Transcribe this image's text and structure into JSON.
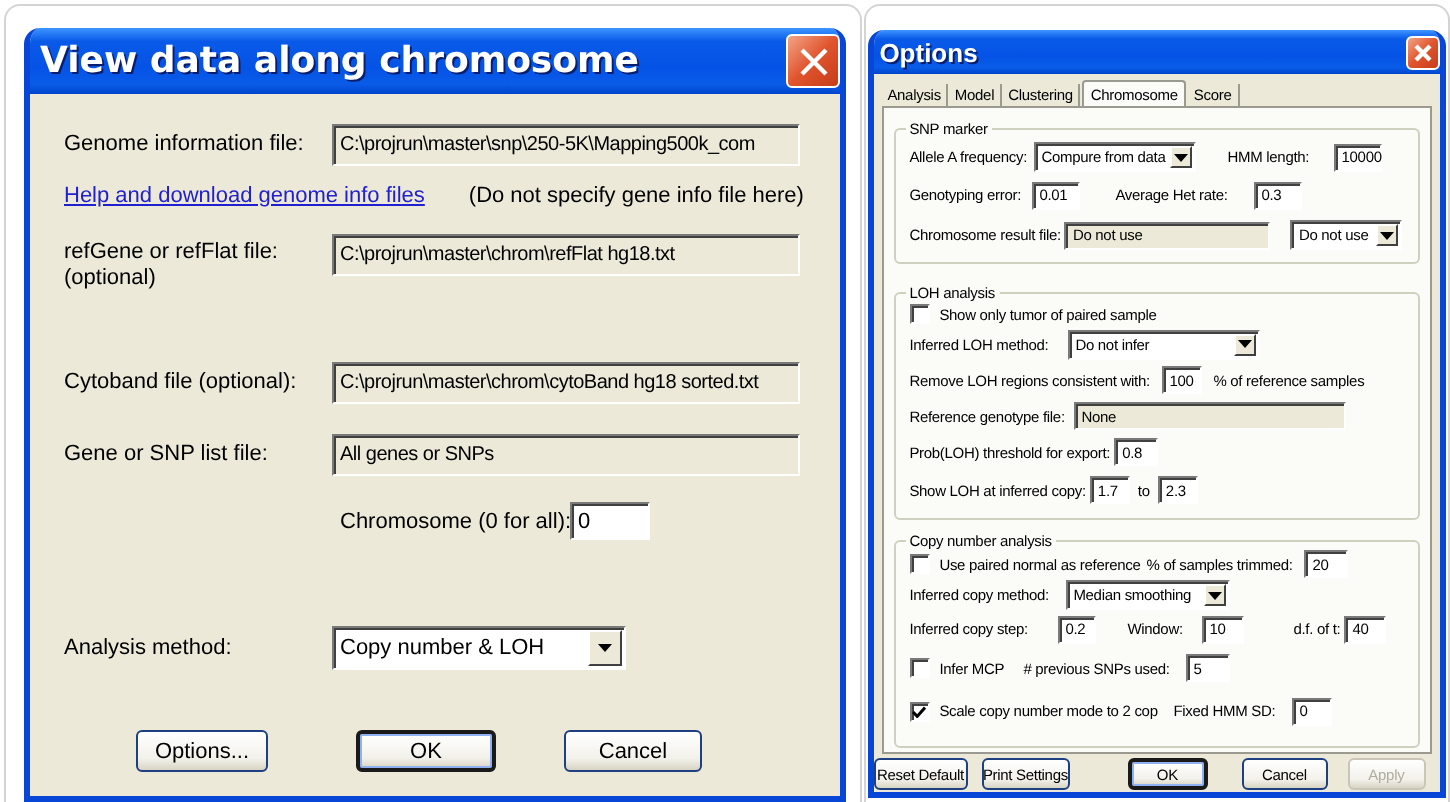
{
  "view_dialog": {
    "title": "View data along chromosome",
    "rows": [
      {
        "kind": "file",
        "label": "Genome information file:",
        "value": "C:\\projrun\\master\\snp\\250-5K\\Mapping500k_com"
      },
      {
        "kind": "link",
        "link": "Help and download genome info files",
        "note": "(Do not specify gene info file here)"
      },
      {
        "kind": "file",
        "label": "refGene or refFlat file:\n(optional)",
        "value": "C:\\projrun\\master\\chrom\\refFlat hg18.txt"
      },
      {
        "kind": "file",
        "label": "Cytoband file (optional):",
        "value": "C:\\projrun\\master\\chrom\\cytoBand hg18 sorted.txt"
      },
      {
        "kind": "file",
        "label": "Gene or SNP list file:",
        "value": "All genes or SNPs"
      },
      {
        "kind": "number",
        "label": "Chromosome (0 for all):",
        "value": "0"
      },
      {
        "kind": "select",
        "label": "Analysis method:",
        "value": "Copy number & LOH"
      }
    ],
    "buttons": [
      {
        "label": "Options...",
        "default": false
      },
      {
        "label": "OK",
        "default": true
      },
      {
        "label": "Cancel",
        "default": false
      }
    ]
  },
  "options": {
    "title": "Options",
    "tabs": [
      {
        "label": "Analysis",
        "selected": false
      },
      {
        "label": "Model",
        "selected": false
      },
      {
        "label": "Clustering",
        "selected": false
      },
      {
        "label": "Chromosome",
        "selected": true
      },
      {
        "label": "Score",
        "selected": false
      }
    ],
    "groups": [
      {
        "title": "SNP marker",
        "rows": [
          {
            "items": [
              {
                "kind": "label",
                "text": "Allele A frequency:"
              },
              {
                "kind": "select",
                "value": "Compure from data"
              },
              {
                "kind": "label",
                "text": "HMM length:"
              },
              {
                "kind": "field",
                "value": "10000"
              }
            ]
          },
          {
            "items": [
              {
                "kind": "label",
                "text": "Genotyping error:"
              },
              {
                "kind": "field",
                "value": "0.01"
              },
              {
                "kind": "label",
                "text": "Average Het rate:"
              },
              {
                "kind": "field",
                "value": "0.3"
              }
            ]
          },
          {
            "items": [
              {
                "kind": "label",
                "text": "Chromosome result file:"
              },
              {
                "kind": "readonly",
                "value": "Do not use"
              },
              {
                "kind": "select",
                "value": "Do not use"
              }
            ]
          }
        ]
      },
      {
        "title": "LOH analysis",
        "rows": [
          {
            "items": [
              {
                "kind": "checkbox",
                "label": "Show only tumor of paired sample",
                "checked": false
              }
            ]
          },
          {
            "items": [
              {
                "kind": "label",
                "text": "Inferred LOH method:"
              },
              {
                "kind": "select",
                "value": "Do not infer"
              }
            ]
          },
          {
            "items": [
              {
                "kind": "label",
                "text": "Remove LOH regions consistent with:"
              },
              {
                "kind": "field",
                "value": "100"
              },
              {
                "kind": "label",
                "text": "% of reference samples"
              }
            ]
          },
          {
            "items": [
              {
                "kind": "label",
                "text": "Reference genotype file:"
              },
              {
                "kind": "readonly",
                "value": "None"
              }
            ]
          },
          {
            "items": [
              {
                "kind": "label",
                "text": "Prob(LOH) threshold for export:"
              },
              {
                "kind": "field",
                "value": "0.8"
              }
            ]
          },
          {
            "items": [
              {
                "kind": "label",
                "text": "Show LOH at inferred copy:"
              },
              {
                "kind": "field",
                "value": "1.7"
              },
              {
                "kind": "label",
                "text": "to"
              },
              {
                "kind": "field",
                "value": "2.3"
              }
            ]
          }
        ]
      },
      {
        "title": "Copy number analysis",
        "rows": [
          {
            "items": [
              {
                "kind": "checkbox",
                "label": "Use paired normal as reference",
                "checked": false
              },
              {
                "kind": "label",
                "text": "% of samples trimmed:"
              },
              {
                "kind": "field",
                "value": "20"
              }
            ]
          },
          {
            "items": [
              {
                "kind": "label",
                "text": "Inferred copy method:"
              },
              {
                "kind": "select",
                "value": "Median smoothing"
              }
            ]
          },
          {
            "items": [
              {
                "kind": "label",
                "text": "Inferred copy step:"
              },
              {
                "kind": "field",
                "value": "0.2"
              },
              {
                "kind": "label",
                "text": "Window:"
              },
              {
                "kind": "field",
                "value": "10"
              },
              {
                "kind": "label",
                "text": "d.f. of t:"
              },
              {
                "kind": "field",
                "value": "40"
              }
            ]
          },
          {
            "items": [
              {
                "kind": "checkbox",
                "label": "Infer MCP",
                "checked": false
              },
              {
                "kind": "label",
                "text": "# previous SNPs used:"
              },
              {
                "kind": "field",
                "value": "5"
              }
            ]
          },
          {
            "items": [
              {
                "kind": "checkbox",
                "label": "Scale copy number mode to 2 cop",
                "checked": true
              },
              {
                "kind": "label",
                "text": "Fixed HMM SD:"
              },
              {
                "kind": "field",
                "value": "0"
              }
            ]
          }
        ]
      }
    ],
    "buttons": [
      {
        "label": "Reset Default",
        "default": false,
        "disabled": false
      },
      {
        "label": "Print Settings",
        "default": false,
        "disabled": false
      },
      {
        "label": "OK",
        "default": true,
        "disabled": false
      },
      {
        "label": "Cancel",
        "default": false,
        "disabled": false
      },
      {
        "label": "Apply",
        "default": false,
        "disabled": true
      }
    ]
  }
}
